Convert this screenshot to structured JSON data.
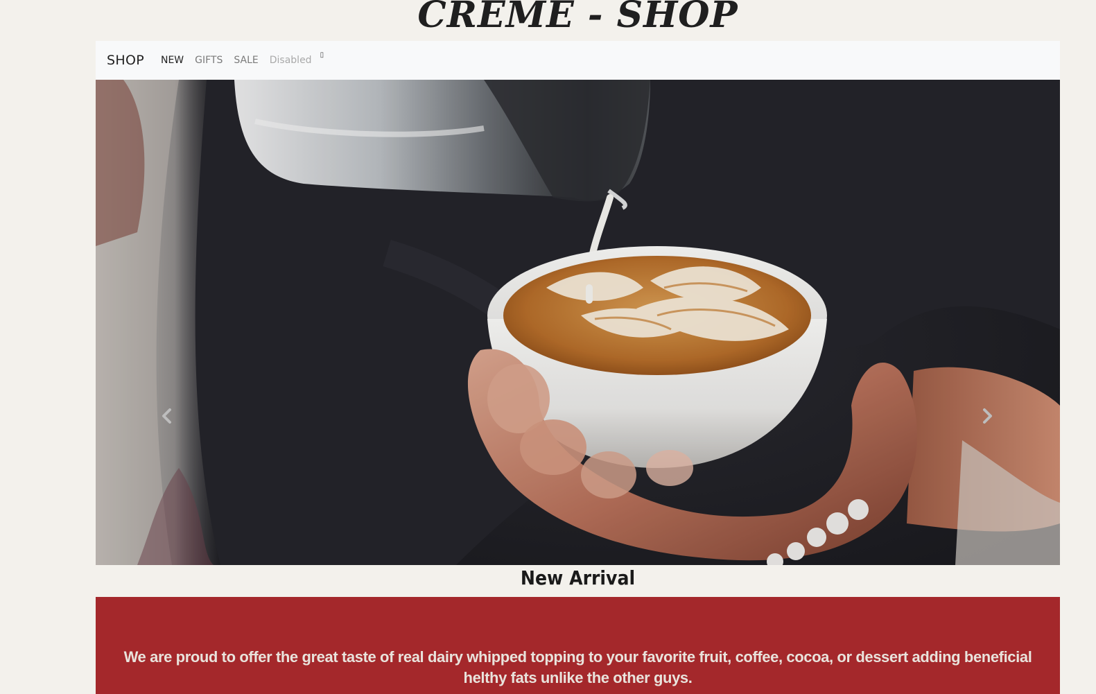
{
  "header": {
    "site_title": "CREME - SHOP"
  },
  "navbar": {
    "brand": "SHOP",
    "links": [
      {
        "label": "NEW",
        "state": "active"
      },
      {
        "label": "GIFTS",
        "state": "normal"
      },
      {
        "label": "SALE",
        "state": "normal"
      },
      {
        "label": "Disabled",
        "state": "disabled"
      }
    ],
    "trailing_glyph": "▯"
  },
  "carousel": {
    "image_subject": "latte-art-pour-photo",
    "prev_icon": "chevron-left-icon",
    "next_icon": "chevron-right-icon"
  },
  "section": {
    "heading": "New Arrival"
  },
  "promo": {
    "text": "We are proud to offer the great taste of real dairy whipped topping to your favorite fruit, coffee, cocoa, or dessert adding beneficial helthy fats unlike the other guys.",
    "background_color": "#a4282b"
  }
}
